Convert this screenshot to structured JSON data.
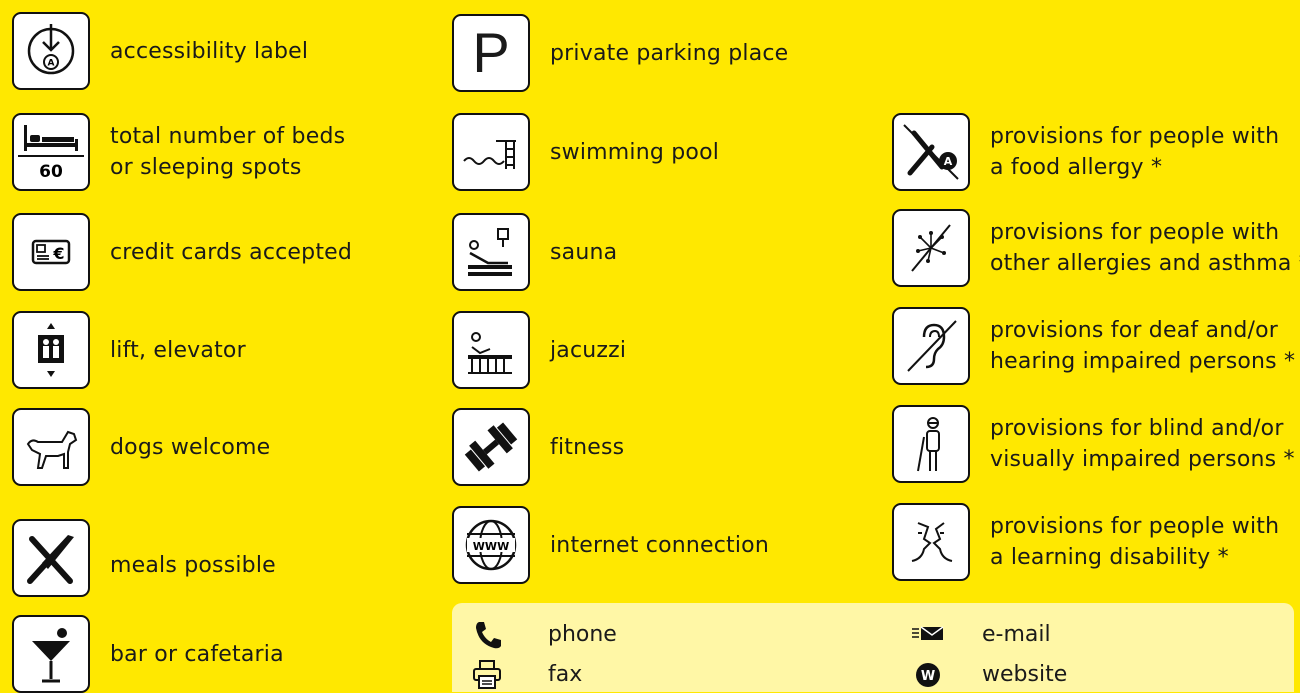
{
  "column_left": [
    {
      "label_lines": [
        "accessibility label"
      ]
    },
    {
      "label_lines": [
        "total number of beds",
        "or sleeping spots"
      ],
      "badge": "60"
    },
    {
      "label_lines": [
        "credit cards accepted"
      ]
    },
    {
      "label_lines": [
        "lift, elevator"
      ]
    },
    {
      "label_lines": [
        "dogs welcome"
      ]
    },
    {
      "label_lines": [
        "meals possible"
      ]
    },
    {
      "label_lines": [
        "bar or cafetaria"
      ]
    }
  ],
  "column_middle": [
    {
      "label_lines": [
        "private parking place"
      ],
      "glyph": "P"
    },
    {
      "label_lines": [
        "swimming pool"
      ]
    },
    {
      "label_lines": [
        "sauna"
      ]
    },
    {
      "label_lines": [
        "jacuzzi"
      ]
    },
    {
      "label_lines": [
        "fitness"
      ]
    },
    {
      "label_lines": [
        "internet connection"
      ],
      "glyph": "WWW"
    }
  ],
  "column_right": [
    {
      "label_lines": [
        "provisions for people with",
        "a food allergy *"
      ],
      "badge": "A"
    },
    {
      "label_lines": [
        "provisions for people with",
        "other allergies and asthma *"
      ]
    },
    {
      "label_lines": [
        "provisions for deaf and/or",
        "hearing impaired persons *"
      ]
    },
    {
      "label_lines": [
        "provisions for blind and/or",
        "visually impaired persons *"
      ]
    },
    {
      "label_lines": [
        "provisions for people with",
        "a learning disability *"
      ]
    }
  ],
  "contacts": [
    {
      "label": "phone"
    },
    {
      "label": "fax"
    },
    {
      "label": "e-mail"
    },
    {
      "label": "website",
      "glyph": "W"
    }
  ],
  "colors": {
    "background": "#ffe800",
    "panel": "#fff7a6",
    "ink": "#111111"
  }
}
